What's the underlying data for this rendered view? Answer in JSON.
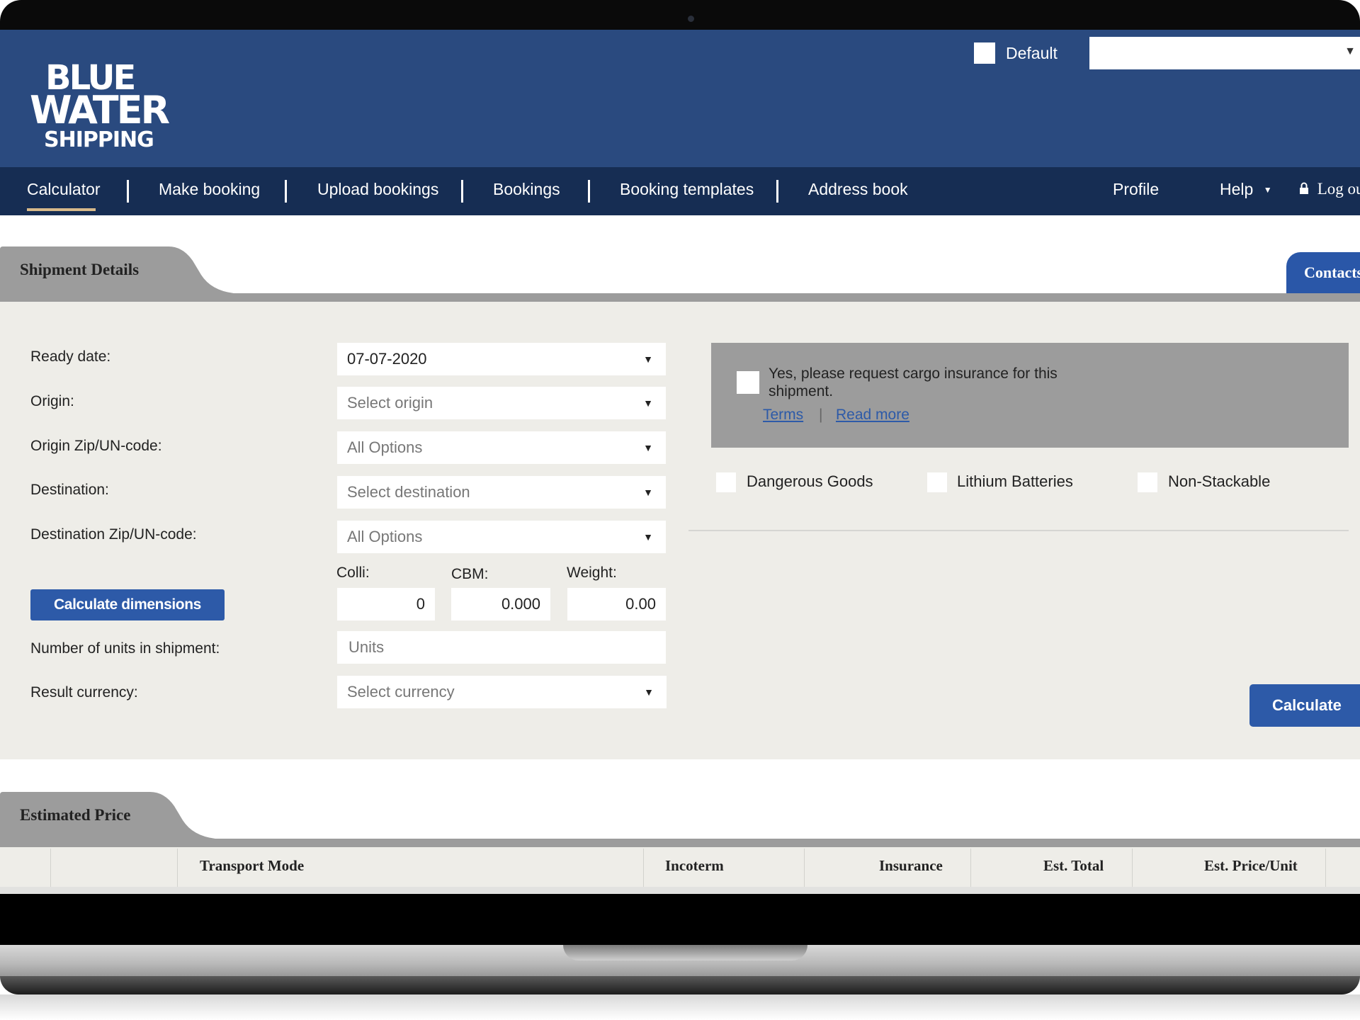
{
  "header": {
    "logo_lines": [
      "BLUE",
      "WATER",
      "SHIPPING"
    ],
    "default_label": "Default",
    "account_select_value": ""
  },
  "nav": {
    "items": [
      "Calculator",
      "Make booking",
      "Upload bookings",
      "Bookings",
      "Booking templates",
      "Address book"
    ],
    "active": "Calculator",
    "right_items": {
      "profile": "Profile",
      "help": "Help",
      "logout": "Log ou"
    }
  },
  "tabs": {
    "shipment_details": "Shipment Details",
    "contacts": "Contacts",
    "estimated_price": "Estimated Price"
  },
  "form": {
    "ready_date": {
      "label": "Ready date:",
      "value": "07-07-2020"
    },
    "origin": {
      "label": "Origin:",
      "placeholder": "Select origin"
    },
    "origin_zip": {
      "label": "Origin Zip/UN-code:",
      "value": "All Options"
    },
    "destination": {
      "label": "Destination:",
      "placeholder": "Select destination"
    },
    "destination_zip": {
      "label": "Destination Zip/UN-code:",
      "value": "All Options"
    },
    "colli": {
      "label": "Colli:",
      "value": "0"
    },
    "cbm": {
      "label": "CBM:",
      "value": "0.000"
    },
    "weight": {
      "label": "Weight:",
      "value": "0.00"
    },
    "calculate_dimensions": "Calculate dimensions",
    "units": {
      "label": "Number of units in shipment:",
      "placeholder": "Units"
    },
    "currency": {
      "label": "Result currency:",
      "placeholder": "Select currency"
    }
  },
  "insurance": {
    "text": "Yes, please request cargo insurance for this shipment.",
    "terms": "Terms",
    "separator": "|",
    "read_more": "Read more",
    "checked": false
  },
  "options": {
    "dangerous_goods": "Dangerous Goods",
    "lithium_batteries": "Lithium Batteries",
    "non_stackable": "Non-Stackable"
  },
  "calculate_button": "Calculate",
  "results_table": {
    "columns": [
      "",
      "",
      "Transport Mode",
      "Incoterm",
      "Insurance",
      "Est. Total",
      "Est. Price/Unit",
      ""
    ]
  },
  "colors": {
    "header_blue": "#2a4a7f",
    "nav_navy": "#162d53",
    "accent_blue": "#2d5aa8",
    "active_underline": "#d7b98a",
    "panel_bg": "#eeede8"
  }
}
